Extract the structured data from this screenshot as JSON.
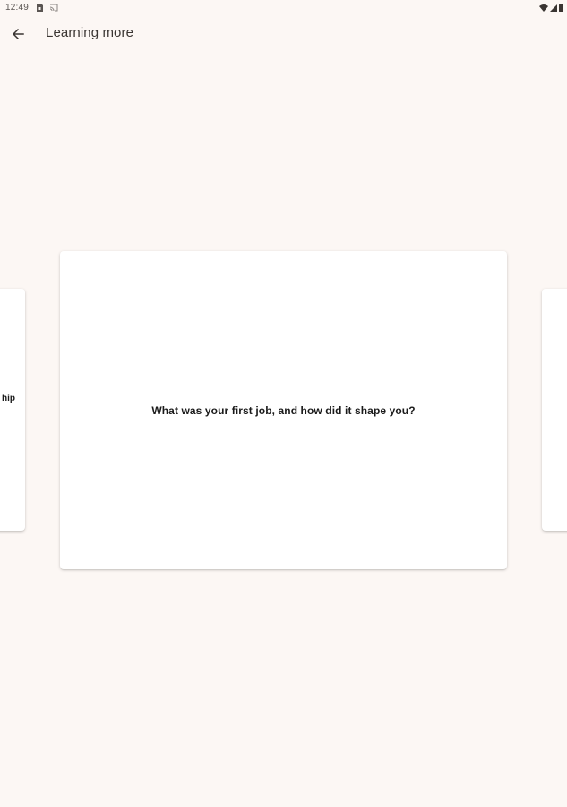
{
  "status_bar": {
    "time": "12:49",
    "left_icons": [
      "sim-card-icon",
      "cast-icon"
    ],
    "right_icons": [
      "wifi-icon",
      "signal-icon",
      "battery-icon"
    ]
  },
  "app_bar": {
    "back_icon": "arrow-back-icon",
    "title": "Learning more"
  },
  "carousel": {
    "prev_card_text": "hip",
    "current_card_text": "What was your first job, and how did it shape you?",
    "next_card_text": ""
  },
  "colors": {
    "background": "#fcf7f4",
    "card": "#ffffff",
    "text": "#1a1a1a"
  }
}
